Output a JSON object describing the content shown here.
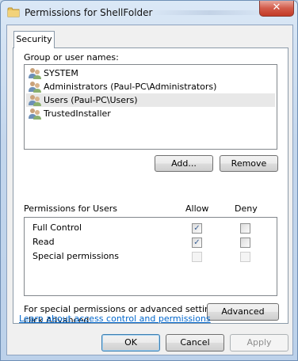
{
  "window": {
    "title": "Permissions for ShellFolder",
    "close_glyph": "✕"
  },
  "tabs": [
    {
      "label": "Security"
    }
  ],
  "group": {
    "label": "Group or user names:",
    "items": [
      {
        "label": "SYSTEM"
      },
      {
        "label": "Administrators (Paul-PC\\Administrators)"
      },
      {
        "label": "Users (Paul-PC\\Users)"
      },
      {
        "label": "TrustedInstaller"
      }
    ],
    "selected_item": "Users (Paul-PC\\Users)",
    "add_label": "Add...",
    "remove_label": "Remove"
  },
  "permissions": {
    "header": "Permissions for Users",
    "allow_label": "Allow",
    "deny_label": "Deny",
    "rows": [
      {
        "label": "Full Control",
        "allow": true,
        "deny": false,
        "enabled": true
      },
      {
        "label": "Read",
        "allow": true,
        "deny": false,
        "enabled": true
      },
      {
        "label": "Special permissions",
        "allow": false,
        "deny": false,
        "enabled": false
      }
    ]
  },
  "advanced": {
    "note_line1": "For special permissions or advanced settings,",
    "note_line2": "click Advanced.",
    "button_label": "Advanced"
  },
  "link_text": "Learn about access control and permissions",
  "footer": {
    "ok_label": "OK",
    "cancel_label": "Cancel",
    "apply_label": "Apply"
  },
  "colors": {
    "link": "#0066cc",
    "check": "#3a5f94",
    "close_button": "#c33a26"
  },
  "icons": {
    "title": "folder-icon",
    "users": "user-group-icon"
  }
}
